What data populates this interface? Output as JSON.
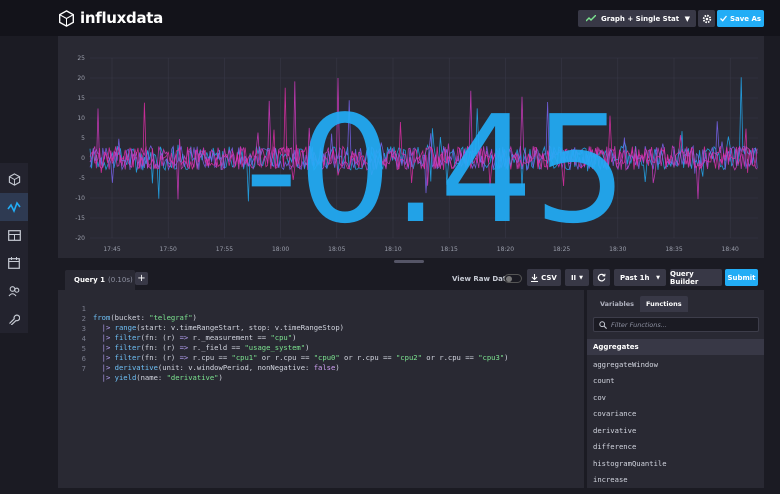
{
  "app": {
    "brand": "influxdata"
  },
  "header": {
    "viz_select_label": "Graph + Single Stat",
    "save_as_label": "Save As"
  },
  "sidebar": {
    "items": [
      {
        "icon": "data-explorer-cube-icon"
      },
      {
        "icon": "graph-line-icon",
        "active": true
      },
      {
        "icon": "dashboards-icon"
      },
      {
        "icon": "calendar-tasks-icon"
      },
      {
        "icon": "alerts-users-icon"
      },
      {
        "icon": "wrench-settings-icon"
      }
    ]
  },
  "single_stat": {
    "value": "-0.45",
    "color": "#22adf6"
  },
  "chart_data": {
    "type": "line",
    "ylim": [
      -20,
      25
    ],
    "yticks": [
      "25",
      "20",
      "15",
      "10",
      "5",
      "0",
      "-5",
      "-10",
      "-15",
      "-20"
    ],
    "xticks": [
      "17:45",
      "17:50",
      "17:55",
      "18:00",
      "18:05",
      "18:10",
      "18:15",
      "18:20",
      "18:25",
      "18:30",
      "18:35",
      "18:40"
    ],
    "series": [
      {
        "color": "#22adf6"
      },
      {
        "color": "#7a65f2"
      },
      {
        "color": "#d439c2"
      },
      {
        "color": "#e32ea8"
      }
    ],
    "grid": true
  },
  "query": {
    "tab_label": "Query 1",
    "tab_time": "(0.10s)",
    "add_label": "+",
    "view_raw_label": "View Raw Data",
    "csv_label": "CSV",
    "pause_label": "II",
    "time_range_label": "Past 1h",
    "query_builder_label": "Query Builder",
    "submit_label": "Submit",
    "lines": [
      {
        "n": "1"
      },
      {
        "n": "2"
      },
      {
        "n": "3"
      },
      {
        "n": "4"
      },
      {
        "n": "5"
      },
      {
        "n": "6"
      },
      {
        "n": "7"
      }
    ],
    "code": {
      "l1": {
        "fn": "from",
        "a": "(bucket: ",
        "s": "\"telegraf\"",
        "b": ")"
      },
      "l2": {
        "pipe": "|>",
        "fn": "range",
        "a": "(start: v.timeRangeStart, stop: v.timeRangeStop)"
      },
      "l3": {
        "pipe": "|>",
        "fn": "filter",
        "a": "(fn: (r) ",
        "arrow": "=>",
        "b": " r._measurement == ",
        "s": "\"cpu\"",
        "c": ")"
      },
      "l4": {
        "pipe": "|>",
        "fn": "filter",
        "a": "(fn: (r) ",
        "arrow": "=>",
        "b": " r._field == ",
        "s": "\"usage_system\"",
        "c": ")"
      },
      "l5": {
        "pipe": "|>",
        "fn": "filter",
        "a": "(fn: (r) ",
        "arrow": "=>",
        "b": " r.cpu == ",
        "s1": "\"cpu1\"",
        "o1": " or r.cpu == ",
        "s2": "\"cpu0\"",
        "o2": " or r.cpu == ",
        "s3": "\"cpu2\"",
        "o3": " or r.cpu == ",
        "s4": "\"cpu3\"",
        "c": ")"
      },
      "l6": {
        "pipe": "|>",
        "fn": "derivative",
        "a": "(unit: v.windowPeriod, nonNegative: ",
        "k": "false",
        "c": ")"
      },
      "l7": {
        "pipe": "|>",
        "fn": "yield",
        "a": "(name: ",
        "s": "\"derivative\"",
        "c": ")"
      }
    }
  },
  "functions_panel": {
    "tabs": [
      "Variables",
      "Functions"
    ],
    "active_tab": "Functions",
    "search_placeholder": "Filter Functions...",
    "category": "Aggregates",
    "items": [
      "aggregateWindow",
      "count",
      "cov",
      "covariance",
      "derivative",
      "difference",
      "histogramQuantile",
      "increase"
    ]
  }
}
